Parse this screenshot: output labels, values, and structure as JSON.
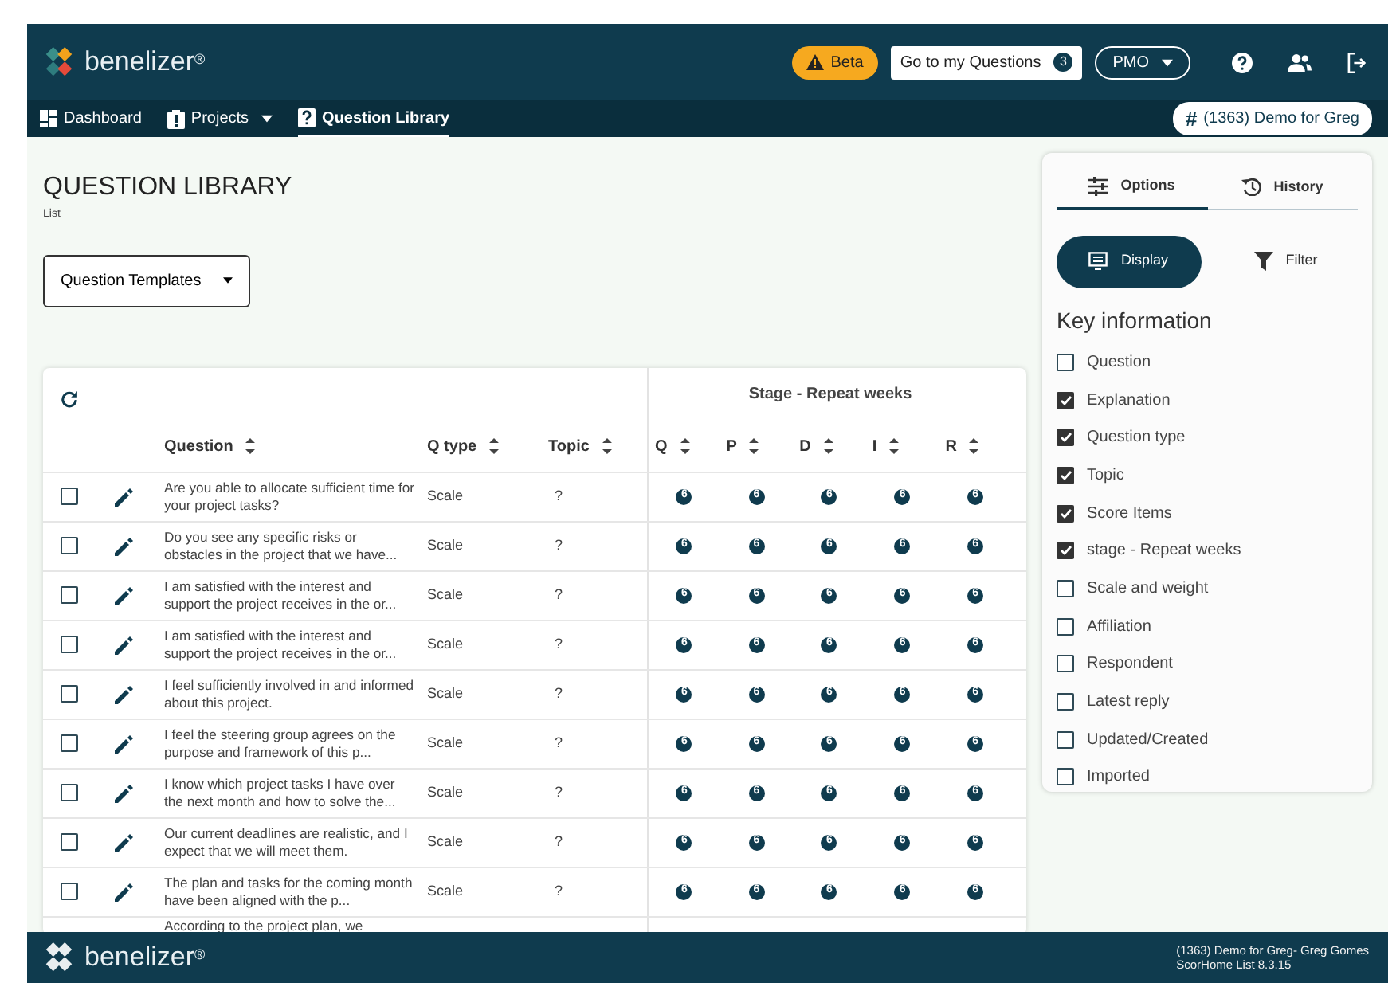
{
  "header": {
    "logo": "benelizer$^{®}$",
    "beta": "Beta",
    "my_questions": {
      "label": "Go to my Questions",
      "count": "3"
    },
    "role": "PMO"
  },
  "nav": [
    {
      "label": "Dashboard",
      "selected": false,
      "kind": "link"
    },
    {
      "label": "Projects",
      "selected": false,
      "kind": "dropdown"
    },
    {
      "label": "Question Library",
      "selected": true,
      "kind": "link"
    }
  ],
  "project_chip": {
    "symbol": "#",
    "label": "(1363) Demo for Greg"
  },
  "page": {
    "title": "QUESTION LIBRARY",
    "subtitle": "List",
    "template_select": "Question Templates"
  },
  "table": {
    "group_header": "Stage - Repeat weeks",
    "columns": [
      "Question",
      "Q type",
      "Topic",
      "Q",
      "P",
      "D",
      "I",
      "R"
    ],
    "rows": [
      {
        "checked": false,
        "question": "Are you able to allocate sufficient time for your project tasks?",
        "q_type": "Scale",
        "topic": "?",
        "scores": [
          "6",
          "6",
          "6",
          "6",
          "6"
        ]
      },
      {
        "checked": false,
        "question": "Do you see any specific risks or obstacles in the project that we have...",
        "q_type": "Scale",
        "topic": "?",
        "scores": [
          "6",
          "6",
          "6",
          "6",
          "6"
        ]
      },
      {
        "checked": false,
        "question": "I am satisfied with the interest and support the project receives in the or...",
        "q_type": "Scale",
        "topic": "?",
        "scores": [
          "6",
          "6",
          "6",
          "6",
          "6"
        ]
      },
      {
        "checked": false,
        "question": "I am satisfied with the interest and support the project receives in the or...",
        "q_type": "Scale",
        "topic": "?",
        "scores": [
          "6",
          "6",
          "6",
          "6",
          "6"
        ]
      },
      {
        "checked": false,
        "question": "I feel sufficiently involved in and informed about this project.",
        "q_type": "Scale",
        "topic": "?",
        "scores": [
          "6",
          "6",
          "6",
          "6",
          "6"
        ]
      },
      {
        "checked": false,
        "question": "I feel the steering group agrees on the purpose and framework of this p...",
        "q_type": "Scale",
        "topic": "?",
        "scores": [
          "6",
          "6",
          "6",
          "6",
          "6"
        ]
      },
      {
        "checked": false,
        "question": "I know which project tasks I have over the next month and how to solve the...",
        "q_type": "Scale",
        "topic": "?",
        "scores": [
          "6",
          "6",
          "6",
          "6",
          "6"
        ]
      },
      {
        "checked": false,
        "question": "Our current deadlines are realistic, and I expect that we will meet them.",
        "q_type": "Scale",
        "topic": "?",
        "scores": [
          "6",
          "6",
          "6",
          "6",
          "6"
        ]
      },
      {
        "checked": false,
        "question": "The plan and tasks for the coming month have been aligned with the p...",
        "q_type": "Scale",
        "topic": "?",
        "scores": [
          "6",
          "6",
          "6",
          "6",
          "6"
        ]
      },
      {
        "question": "According to the project plan, we"
      }
    ]
  },
  "panel": {
    "tabs": [
      {
        "label": "Options",
        "selected": true,
        "kind": "options"
      },
      {
        "label": "History",
        "selected": false,
        "kind": "history"
      }
    ],
    "modes": [
      {
        "label": "Display",
        "selected": true,
        "kind": "display"
      },
      {
        "label": "Filter",
        "selected": false,
        "kind": "filter"
      }
    ],
    "heading": "Key information",
    "options": [
      {
        "label": "Question",
        "checked": false
      },
      {
        "label": "Explanation",
        "checked": true
      },
      {
        "label": "Question type",
        "checked": true
      },
      {
        "label": "Topic",
        "checked": true
      },
      {
        "label": "Score Items",
        "checked": true
      },
      {
        "label": "stage - Repeat weeks",
        "checked": true
      },
      {
        "label": "Scale and weight",
        "checked": false
      },
      {
        "label": "Affiliation",
        "checked": false
      },
      {
        "label": "Respondent",
        "checked": false
      },
      {
        "label": "Latest reply",
        "checked": false
      },
      {
        "label": "Updated/Created",
        "checked": false
      },
      {
        "label": "Imported",
        "checked": false
      }
    ]
  },
  "footer": {
    "logo": "benelizer$^{®}$",
    "project": "(1363) Demo for Greg- Greg Gomes",
    "version": "ScorHome List 8.3.15"
  }
}
